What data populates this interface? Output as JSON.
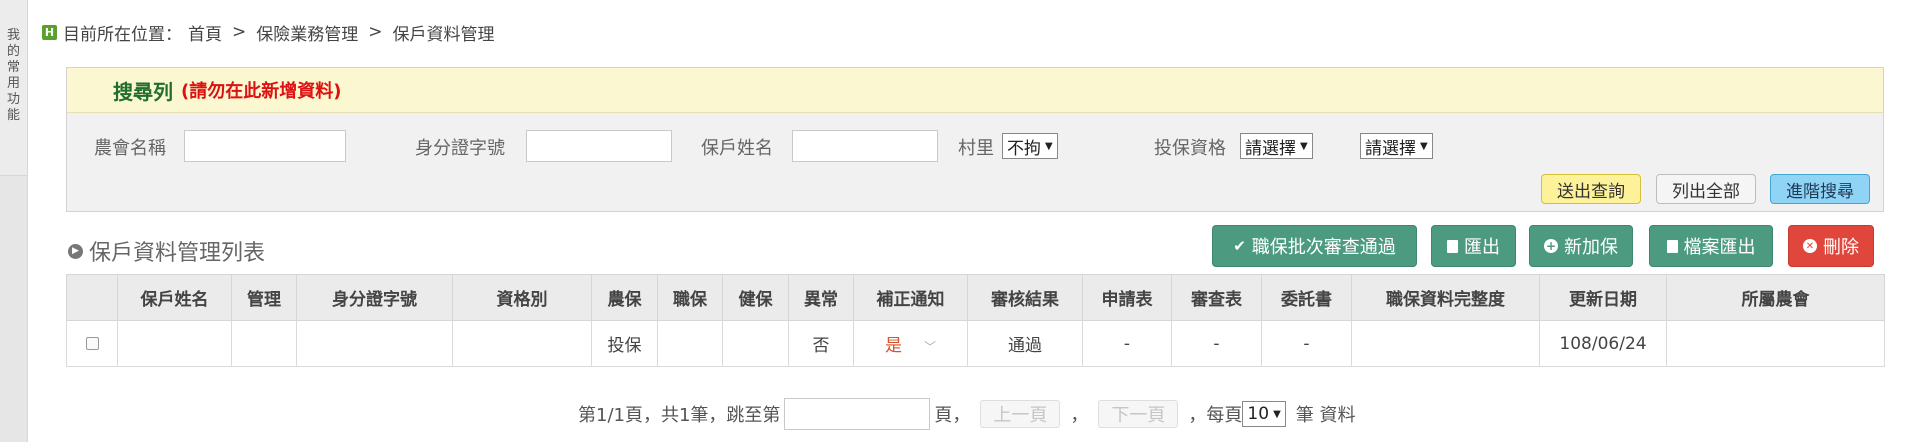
{
  "sidebar": {
    "tab_chars": [
      "我",
      "的",
      "常",
      "用",
      "功",
      "能"
    ]
  },
  "breadcrumb": {
    "icon_letter": "H",
    "prefix": "目前所在位置：",
    "items": [
      "首頁",
      "保險業務管理",
      "保戶資料管理"
    ],
    "separator": ">"
  },
  "search": {
    "title": "搜尋列",
    "note": "(請勿在此新增資料)",
    "fields": {
      "farmers_assoc_label": "農會名稱",
      "id_number_label": "身分證字號",
      "holder_name_label": "保戶姓名",
      "village_label": "村里",
      "village_value": "不拘",
      "eligibility_label": "投保資格",
      "eligibility_value": "請選擇",
      "eligibility_sub_value": "請選擇"
    },
    "buttons": {
      "submit": "送出查詢",
      "list_all": "列出全部",
      "advanced": "進階搜尋"
    }
  },
  "list": {
    "title": "保戶資料管理列表",
    "actions": {
      "batch_approve": "職保批次審查通過",
      "export": "匯出",
      "add": "新加保",
      "file_export": "檔案匯出",
      "delete": "刪除"
    },
    "columns": [
      "",
      "保戶姓名",
      "管理",
      "身分證字號",
      "資格別",
      "農保",
      "職保",
      "健保",
      "異常",
      "補正通知",
      "審核結果",
      "申請表",
      "審查表",
      "委託書",
      "職保資料完整度",
      "更新日期",
      "所屬農會"
    ],
    "rows": [
      {
        "holder_name": "",
        "manage": "",
        "id_number": "",
        "qualification": "",
        "farmer_ins": "投保",
        "occupational_ins": "",
        "health_ins": "",
        "abnormal": "否",
        "correction_notice": "是",
        "review_result": "通過",
        "application_form": "-",
        "review_form": "-",
        "power_of_attorney": "-",
        "completeness": "",
        "updated": "108/06/24",
        "farmers_assoc": ""
      }
    ]
  },
  "pager": {
    "summary": "第1/1頁，共1筆，跳至第",
    "page_unit": "頁，",
    "prev": "上一頁",
    "comma": "，",
    "next": "下一頁",
    "per_page_prefix": "，每頁",
    "per_page_value": "10",
    "per_page_suffix": "筆 資料"
  },
  "colors": {
    "accent_green": "#4c9a80",
    "danger_red": "#e0463b",
    "search_header_bg": "#fbf8d1",
    "title_green": "#1f6e2c"
  },
  "icons": [
    "h-badge-icon",
    "circle-arrow-icon",
    "check-icon",
    "document-icon",
    "plus-circle-icon",
    "file-icon",
    "close-circle-icon",
    "chevron-down-icon",
    "dropdown-arrow-icon"
  ]
}
